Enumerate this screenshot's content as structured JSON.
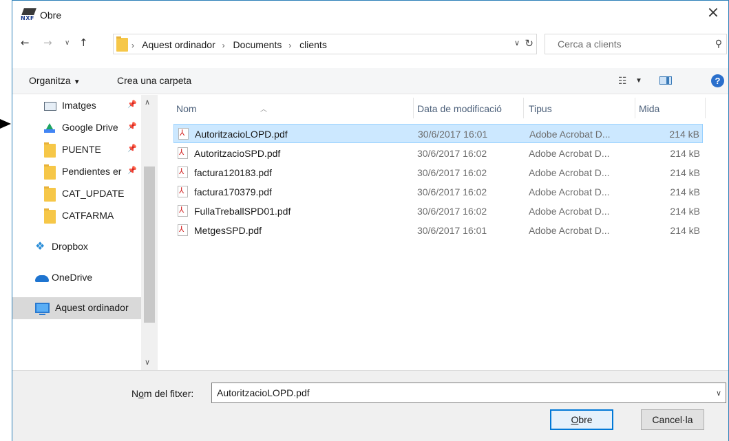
{
  "window": {
    "title": "Obre",
    "icon": "nxf-app-icon",
    "app_icon_text": "NXF",
    "close_glyph": "×"
  },
  "address": {
    "breadcrumbs": [
      "Aquest ordinador",
      "Documents",
      "clients"
    ],
    "search_placeholder": "Cerca a clients"
  },
  "toolbar": {
    "organize_label": "Organitza",
    "new_folder_label": "Crea una carpeta"
  },
  "nav_pane": {
    "items": [
      {
        "label": "Imatges",
        "icon": "pictures-icon",
        "pinned": true
      },
      {
        "label": "Google Drive",
        "icon": "google-drive-icon",
        "pinned": true
      },
      {
        "label": "PUENTE",
        "icon": "folder-icon",
        "pinned": true
      },
      {
        "label": "Pendientes er",
        "icon": "folder-icon",
        "pinned": true
      },
      {
        "label": "CAT_UPDATE",
        "icon": "folder-icon",
        "pinned": false
      },
      {
        "label": "CATFARMA",
        "icon": "folder-icon",
        "pinned": false
      },
      {
        "label": "Dropbox",
        "icon": "dropbox-icon",
        "pinned": false
      },
      {
        "label": "OneDrive",
        "icon": "onedrive-icon",
        "pinned": false
      },
      {
        "label": "Aquest ordinador",
        "icon": "computer-icon",
        "pinned": false,
        "selected": true
      }
    ]
  },
  "file_list": {
    "columns": [
      "Nom",
      "Data de modificació",
      "Tipus",
      "Mida"
    ],
    "rows": [
      {
        "name": "AutoritzacioLOPD.pdf",
        "date": "30/6/2017 16:01",
        "type": "Adobe Acrobat D...",
        "size": "214 kB",
        "selected": true
      },
      {
        "name": "AutoritzacioSPD.pdf",
        "date": "30/6/2017 16:02",
        "type": "Adobe Acrobat D...",
        "size": "214 kB"
      },
      {
        "name": "factura120183.pdf",
        "date": "30/6/2017 16:02",
        "type": "Adobe Acrobat D...",
        "size": "214 kB"
      },
      {
        "name": "factura170379.pdf",
        "date": "30/6/2017 16:02",
        "type": "Adobe Acrobat D...",
        "size": "214 kB"
      },
      {
        "name": "FullaTreballSPD01.pdf",
        "date": "30/6/2017 16:02",
        "type": "Adobe Acrobat D...",
        "size": "214 kB"
      },
      {
        "name": "MetgesSPD.pdf",
        "date": "30/6/2017 16:01",
        "type": "Adobe Acrobat D...",
        "size": "214 kB"
      }
    ]
  },
  "bottom": {
    "filename_label_pre": "N",
    "filename_label_underlined": "o",
    "filename_label_post": "m del fitxer:",
    "filename_value": "AutoritzacioLOPD.pdf",
    "open_button_pre": "",
    "open_button_underlined": "O",
    "open_button_post": "bre",
    "cancel_button": "Cancel·la"
  },
  "colors": {
    "accent": "#0078d7",
    "selection_bg": "#cce8ff",
    "selection_border": "#99d1ff",
    "folder": "#f6c748",
    "window_border": "#2b7fb8"
  }
}
